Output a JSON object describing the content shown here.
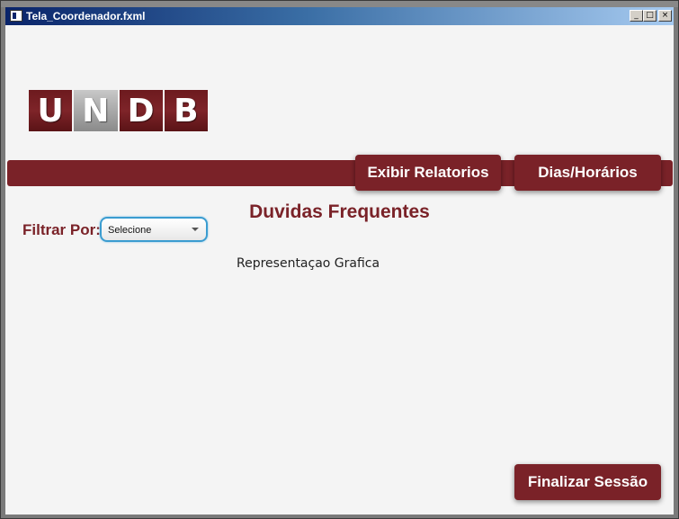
{
  "window": {
    "title": "Tela_Coordenador.fxml",
    "controls": {
      "minimize": "_",
      "maximize": "□",
      "close": "×"
    }
  },
  "logo": {
    "letters": [
      "U",
      "N",
      "D",
      "B"
    ]
  },
  "nav": {
    "exibir_relatorios": "Exibir Relatorios",
    "dias_horarios": "Dias/Horários"
  },
  "main": {
    "title": "Duvidas Frequentes",
    "filter_label": "Filtrar Por:",
    "filter_select": "Selecione",
    "representation": "Representaçao Grafica"
  },
  "footer": {
    "finalizar": "Finalizar Sessão"
  },
  "colors": {
    "brand": "#7a2228",
    "select_border": "#3a9cd0"
  },
  "icons": {
    "select_arrow": "chevron-down-icon",
    "window_icon": "app-window-icon"
  }
}
